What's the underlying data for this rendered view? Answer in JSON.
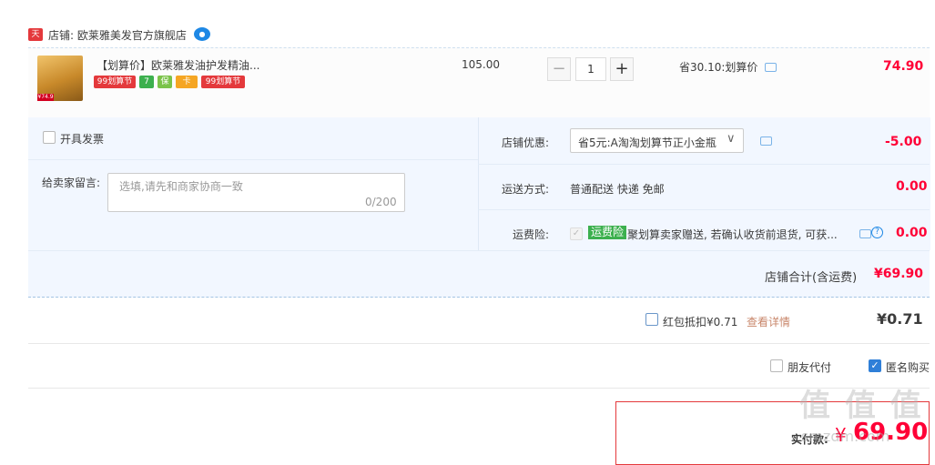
{
  "shop": {
    "tmall_badge": "天猫",
    "label": "店铺:",
    "name": "欧莱雅美发官方旗舰店",
    "ww_icon": "chat-bubble-icon"
  },
  "item": {
    "title": "【划算价】欧莱雅发油护发精油...",
    "unit_price": "105.00",
    "quantity": "1",
    "minus": "−",
    "plus": "+",
    "discount_note": "省30.10:划算价",
    "total": "74.90",
    "thumb_tag": "¥74.9",
    "tags": [
      {
        "text": "99划算节",
        "color": "#e4393c"
      },
      {
        "text": "7",
        "color": "#3cb04e"
      },
      {
        "text": "保",
        "color": "#7bc34a"
      },
      {
        "text": "卡",
        "color": "#f5a623"
      },
      {
        "text": "99划算节",
        "color": "#e4393c"
      }
    ]
  },
  "options": {
    "invoice_label": "开具发票",
    "message_label": "给卖家留言:",
    "message_placeholder": "选填,请先和商家协商一致",
    "message_count": "0/200",
    "shop_discount_label": "店铺优惠:",
    "shop_discount_value": "省5元:A淘淘划算节正小金瓶",
    "shop_discount_amount": "-5.00",
    "shipping_label": "运送方式:",
    "shipping_value": "普通配送 快递 免邮",
    "shipping_amount": "0.00",
    "insurance_label": "运费险:",
    "insurance_tag": "运费险",
    "insurance_text": "聚划算卖家赠送, 若确认收货前退货, 可获...",
    "insurance_amount": "0.00",
    "subtotal_label": "店铺合计(含运费)",
    "subtotal_value": "¥69.90"
  },
  "redpacket": {
    "label": "红包抵扣¥0.71",
    "detail_link": "查看详情",
    "amount": "¥0.71"
  },
  "payment_opts": {
    "friend_pay": "朋友代付",
    "anonymous": "匿名购买",
    "anonymous_checked": true
  },
  "final": {
    "label": "实付款:",
    "currency": "¥",
    "amount": "69.90"
  },
  "watermark": "值 值 值",
  "watermark_sub": "smzdm.com",
  "colors": {
    "accent": "#ff0036",
    "blue": "#1e88e5",
    "panel": "#f2f7ff"
  }
}
